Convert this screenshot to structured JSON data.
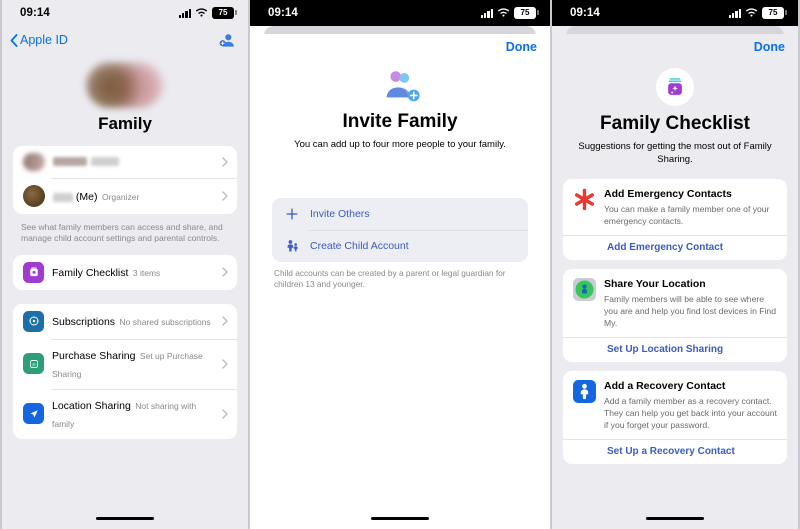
{
  "status_bar": {
    "time": "09:14",
    "battery_level": "75",
    "cellular_icon": "cellular-bars-icon",
    "wifi_icon": "wifi-icon",
    "battery_icon": "battery-icon"
  },
  "panel_family": {
    "nav": {
      "back_label": "Apple ID",
      "back_icon": "chevron-left-icon",
      "add_member_icon": "person-badge-plus-icon"
    },
    "title": "Family",
    "members_card": {
      "rows": [
        {
          "name_redacted": true,
          "title": "",
          "subtitle": ""
        },
        {
          "name_redacted": true,
          "title": "(Me)",
          "subtitle": "Organizer"
        }
      ]
    },
    "members_footnote": "See what family members can access and share, and manage child account settings and parental controls.",
    "checklist_card": {
      "title": "Family Checklist",
      "subtitle": "3 items",
      "icon": "checklist-app-icon",
      "icon_color": "#a03bd0"
    },
    "services": [
      {
        "title": "Subscriptions",
        "subtitle": "No shared subscriptions",
        "icon": "subscriptions-icon",
        "icon_color": "#1d6fa8"
      },
      {
        "title": "Purchase Sharing",
        "subtitle": "Set up Purchase Sharing",
        "icon": "purchase-sharing-icon",
        "icon_color": "#2e9e7a"
      },
      {
        "title": "Location Sharing",
        "subtitle": "Not sharing with family",
        "icon": "location-arrow-icon",
        "icon_color": "#1566e0"
      }
    ]
  },
  "panel_invite": {
    "done_label": "Done",
    "hero_icon": "invite-family-people-icon",
    "title": "Invite Family",
    "subtitle": "You can add up to four more people to your family.",
    "actions": [
      {
        "label": "Invite Others",
        "icon": "plus-icon"
      },
      {
        "label": "Create Child Account",
        "icon": "child-person-icon"
      }
    ],
    "footnote": "Child accounts can be created by a parent or legal guardian for children 13 and younger.",
    "accent_color": "#3b5cc4"
  },
  "panel_checklist": {
    "done_label": "Done",
    "hero_icon": "family-checklist-icon",
    "title": "Family Checklist",
    "subtitle": "Suggestions for getting the most out of Family Sharing.",
    "items": [
      {
        "title": "Add Emergency Contacts",
        "description": "You can make a family member one of your emergency contacts.",
        "link": "Add Emergency Contact",
        "icon": "medical-id-asterisk-icon",
        "icon_color": "#e8382f"
      },
      {
        "title": "Share Your Location",
        "description": "Family members will be able to see where you are and help you find lost devices in Find My.",
        "link": "Set Up Location Sharing",
        "icon": "find-my-icon",
        "icon_color": "#35c759"
      },
      {
        "title": "Add a Recovery Contact",
        "description": "Add a family member as a recovery contact. They can help you get back into your account if you forget your password.",
        "link": "Set Up a Recovery Contact",
        "icon": "recovery-contact-icon",
        "icon_color": "#1566e0"
      }
    ],
    "accent_color": "#3b5cc4"
  }
}
